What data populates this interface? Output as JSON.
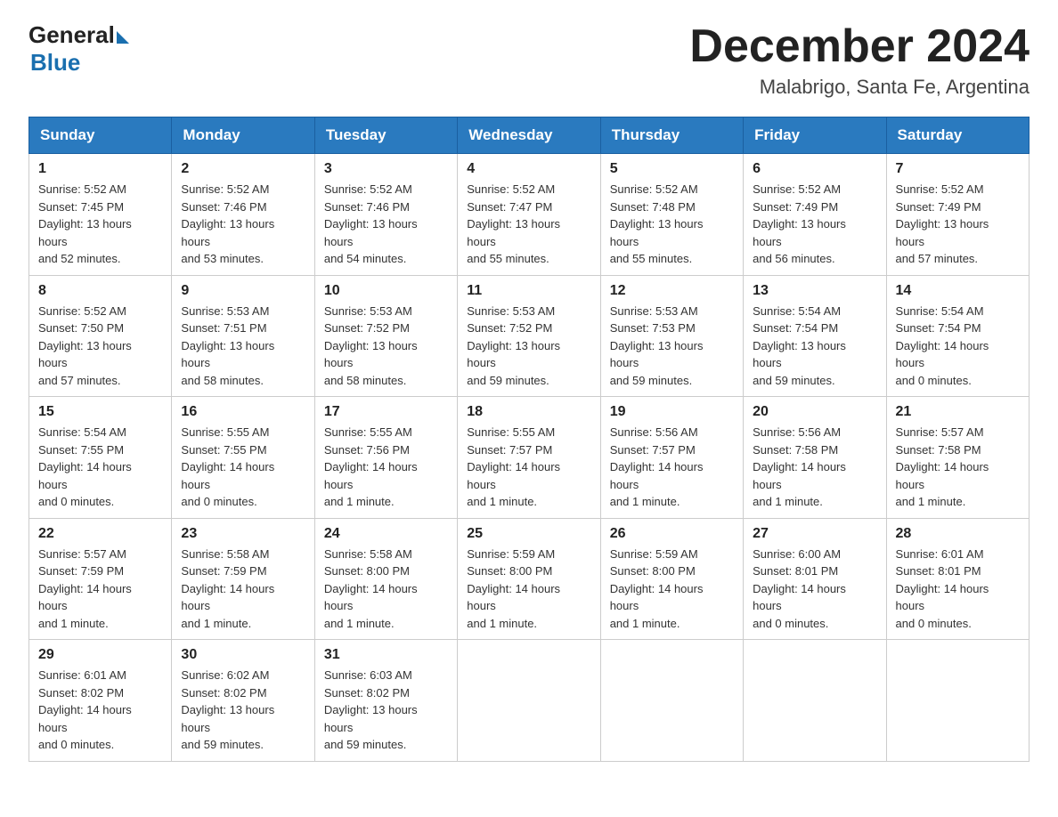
{
  "header": {
    "logo_general": "General",
    "logo_blue": "Blue",
    "month_title": "December 2024",
    "location": "Malabrigo, Santa Fe, Argentina"
  },
  "columns": [
    "Sunday",
    "Monday",
    "Tuesday",
    "Wednesday",
    "Thursday",
    "Friday",
    "Saturday"
  ],
  "weeks": [
    [
      {
        "day": "1",
        "sunrise": "5:52 AM",
        "sunset": "7:45 PM",
        "daylight": "13 hours and 52 minutes."
      },
      {
        "day": "2",
        "sunrise": "5:52 AM",
        "sunset": "7:46 PM",
        "daylight": "13 hours and 53 minutes."
      },
      {
        "day": "3",
        "sunrise": "5:52 AM",
        "sunset": "7:46 PM",
        "daylight": "13 hours and 54 minutes."
      },
      {
        "day": "4",
        "sunrise": "5:52 AM",
        "sunset": "7:47 PM",
        "daylight": "13 hours and 55 minutes."
      },
      {
        "day": "5",
        "sunrise": "5:52 AM",
        "sunset": "7:48 PM",
        "daylight": "13 hours and 55 minutes."
      },
      {
        "day": "6",
        "sunrise": "5:52 AM",
        "sunset": "7:49 PM",
        "daylight": "13 hours and 56 minutes."
      },
      {
        "day": "7",
        "sunrise": "5:52 AM",
        "sunset": "7:49 PM",
        "daylight": "13 hours and 57 minutes."
      }
    ],
    [
      {
        "day": "8",
        "sunrise": "5:52 AM",
        "sunset": "7:50 PM",
        "daylight": "13 hours and 57 minutes."
      },
      {
        "day": "9",
        "sunrise": "5:53 AM",
        "sunset": "7:51 PM",
        "daylight": "13 hours and 58 minutes."
      },
      {
        "day": "10",
        "sunrise": "5:53 AM",
        "sunset": "7:52 PM",
        "daylight": "13 hours and 58 minutes."
      },
      {
        "day": "11",
        "sunrise": "5:53 AM",
        "sunset": "7:52 PM",
        "daylight": "13 hours and 59 minutes."
      },
      {
        "day": "12",
        "sunrise": "5:53 AM",
        "sunset": "7:53 PM",
        "daylight": "13 hours and 59 minutes."
      },
      {
        "day": "13",
        "sunrise": "5:54 AM",
        "sunset": "7:54 PM",
        "daylight": "13 hours and 59 minutes."
      },
      {
        "day": "14",
        "sunrise": "5:54 AM",
        "sunset": "7:54 PM",
        "daylight": "14 hours and 0 minutes."
      }
    ],
    [
      {
        "day": "15",
        "sunrise": "5:54 AM",
        "sunset": "7:55 PM",
        "daylight": "14 hours and 0 minutes."
      },
      {
        "day": "16",
        "sunrise": "5:55 AM",
        "sunset": "7:55 PM",
        "daylight": "14 hours and 0 minutes."
      },
      {
        "day": "17",
        "sunrise": "5:55 AM",
        "sunset": "7:56 PM",
        "daylight": "14 hours and 1 minute."
      },
      {
        "day": "18",
        "sunrise": "5:55 AM",
        "sunset": "7:57 PM",
        "daylight": "14 hours and 1 minute."
      },
      {
        "day": "19",
        "sunrise": "5:56 AM",
        "sunset": "7:57 PM",
        "daylight": "14 hours and 1 minute."
      },
      {
        "day": "20",
        "sunrise": "5:56 AM",
        "sunset": "7:58 PM",
        "daylight": "14 hours and 1 minute."
      },
      {
        "day": "21",
        "sunrise": "5:57 AM",
        "sunset": "7:58 PM",
        "daylight": "14 hours and 1 minute."
      }
    ],
    [
      {
        "day": "22",
        "sunrise": "5:57 AM",
        "sunset": "7:59 PM",
        "daylight": "14 hours and 1 minute."
      },
      {
        "day": "23",
        "sunrise": "5:58 AM",
        "sunset": "7:59 PM",
        "daylight": "14 hours and 1 minute."
      },
      {
        "day": "24",
        "sunrise": "5:58 AM",
        "sunset": "8:00 PM",
        "daylight": "14 hours and 1 minute."
      },
      {
        "day": "25",
        "sunrise": "5:59 AM",
        "sunset": "8:00 PM",
        "daylight": "14 hours and 1 minute."
      },
      {
        "day": "26",
        "sunrise": "5:59 AM",
        "sunset": "8:00 PM",
        "daylight": "14 hours and 1 minute."
      },
      {
        "day": "27",
        "sunrise": "6:00 AM",
        "sunset": "8:01 PM",
        "daylight": "14 hours and 0 minutes."
      },
      {
        "day": "28",
        "sunrise": "6:01 AM",
        "sunset": "8:01 PM",
        "daylight": "14 hours and 0 minutes."
      }
    ],
    [
      {
        "day": "29",
        "sunrise": "6:01 AM",
        "sunset": "8:02 PM",
        "daylight": "14 hours and 0 minutes."
      },
      {
        "day": "30",
        "sunrise": "6:02 AM",
        "sunset": "8:02 PM",
        "daylight": "13 hours and 59 minutes."
      },
      {
        "day": "31",
        "sunrise": "6:03 AM",
        "sunset": "8:02 PM",
        "daylight": "13 hours and 59 minutes."
      },
      null,
      null,
      null,
      null
    ]
  ],
  "labels": {
    "sunrise": "Sunrise:",
    "sunset": "Sunset:",
    "daylight": "Daylight:"
  }
}
